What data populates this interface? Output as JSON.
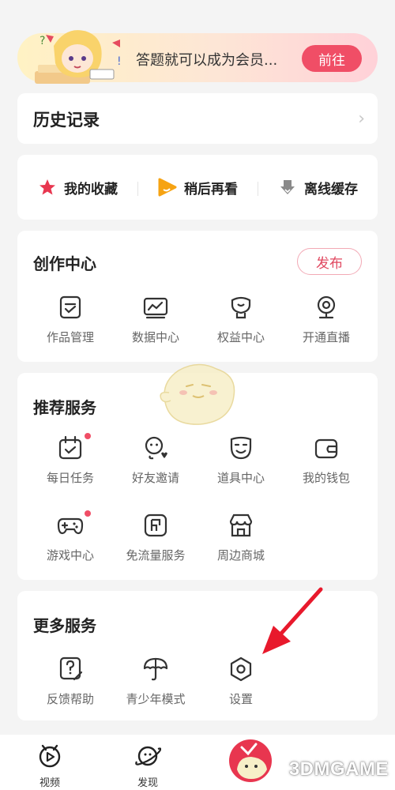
{
  "banner": {
    "text": "答题就可以成为会员...",
    "button": "前往"
  },
  "history": {
    "title": "历史记录",
    "chevron_icon": "chevron-right-icon"
  },
  "quick_links": [
    {
      "label": "我的收藏",
      "icon": "star-icon",
      "color": "#e8364f"
    },
    {
      "label": "稍后再看",
      "icon": "play-later-icon",
      "color": "#f6a313"
    },
    {
      "label": "离线缓存",
      "icon": "download-icon",
      "color": "#8a8a8a"
    }
  ],
  "create_center": {
    "title": "创作中心",
    "publish": "发布",
    "items": [
      {
        "label": "作品管理",
        "icon": "works-manage-icon"
      },
      {
        "label": "数据中心",
        "icon": "data-center-icon"
      },
      {
        "label": "权益中心",
        "icon": "benefits-icon"
      },
      {
        "label": "开通直播",
        "icon": "webcam-icon"
      }
    ]
  },
  "recommended": {
    "title": "推荐服务",
    "items": [
      {
        "label": "每日任务",
        "icon": "calendar-check-icon",
        "dot": true
      },
      {
        "label": "好友邀请",
        "icon": "friend-invite-icon",
        "dot": false
      },
      {
        "label": "道具中心",
        "icon": "mask-icon",
        "dot": false
      },
      {
        "label": "我的钱包",
        "icon": "wallet-icon",
        "dot": false
      },
      {
        "label": "游戏中心",
        "icon": "gamepad-icon",
        "dot": true
      },
      {
        "label": "免流量服务",
        "icon": "sim-card-icon",
        "dot": false
      },
      {
        "label": "周边商城",
        "icon": "store-icon",
        "dot": false
      }
    ]
  },
  "more_services": {
    "title": "更多服务",
    "items": [
      {
        "label": "反馈帮助",
        "icon": "feedback-help-icon"
      },
      {
        "label": "青少年模式",
        "icon": "umbrella-icon"
      },
      {
        "label": "设置",
        "icon": "settings-hexagon-icon"
      }
    ]
  },
  "bottom_nav": [
    {
      "label": "视频",
      "icon": "video-tab-icon"
    },
    {
      "label": "发现",
      "icon": "planet-icon"
    },
    {
      "label": "",
      "icon": "avatar-mascot-icon"
    }
  ],
  "watermark": "3DMGAME",
  "colors": {
    "accent": "#f04e66",
    "bg": "#f4f4f4",
    "card": "#ffffff",
    "text": "#222222",
    "muted": "#666666"
  }
}
